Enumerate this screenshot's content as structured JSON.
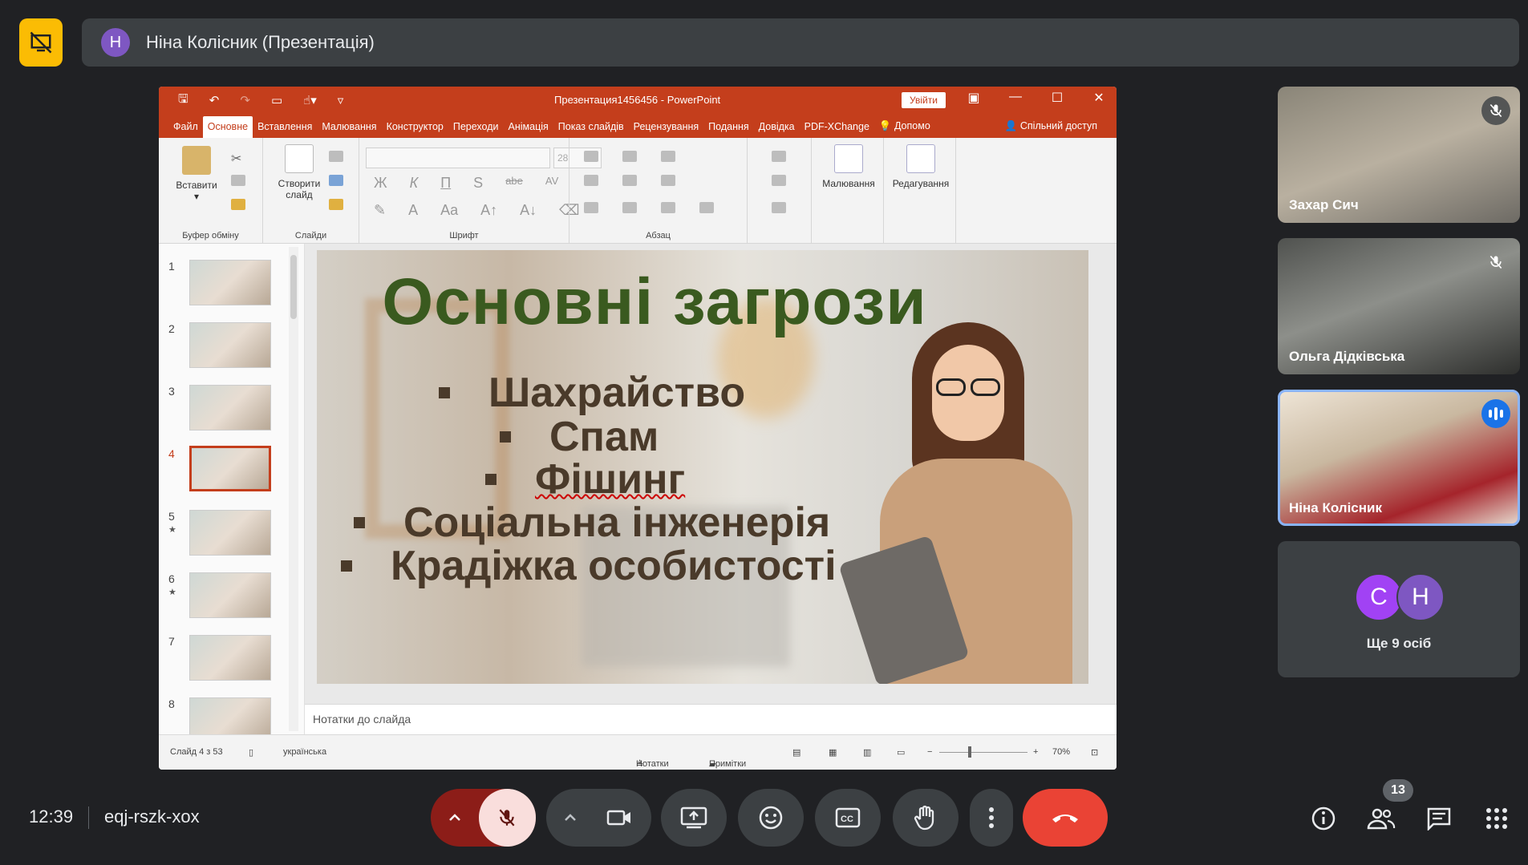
{
  "meet": {
    "presenter_initial": "Н",
    "presenter_name": "Ніна Колісник (Презентація)",
    "time": "12:39",
    "meeting_code": "eqj-rszk-xox",
    "participant_count": "13"
  },
  "powerpoint": {
    "doc_title": "Презентация1456456 - PowerPoint",
    "login_label": "Увійти",
    "tabs": [
      "Файл",
      "Основне",
      "Вставлення",
      "Малювання",
      "Конструктор",
      "Переходи",
      "Анімація",
      "Показ слайдів",
      "Рецензування",
      "Подання",
      "Довідка",
      "PDF-XChange",
      "Допомо"
    ],
    "share_label": "Спільний доступ",
    "ribbon": {
      "paste_label": "Вставити",
      "clipboard_group": "Буфер обміну",
      "new_slide_label": "Створити слайд",
      "slides_group": "Слайди",
      "font_group": "Шрифт",
      "font_size": "28",
      "paragraph_group": "Абзац",
      "drawing_label": "Малювання",
      "editing_label": "Редагування",
      "fmt_bold": "Ж",
      "fmt_italic": "К",
      "fmt_underline": "П",
      "fmt_shadow": "S",
      "fmt_strike": "abe",
      "fmt_spacing": "AV"
    },
    "thumb_numbers": [
      "1",
      "2",
      "3",
      "4",
      "5",
      "6",
      "7",
      "8"
    ],
    "selected_slide": "4",
    "slide": {
      "title": "Основні загрози",
      "bullets": [
        "Шахрайство",
        "Спам",
        "Фішинг",
        "Соціальна інженерія",
        "Крадіжка особистості"
      ]
    },
    "notes_placeholder": "Нотатки до слайда",
    "status": {
      "slide_info": "Слайд 4 з 53",
      "language": "українська",
      "notes_btn": "Нотатки",
      "comments_btn": "Примітки",
      "zoom": "70%"
    }
  },
  "participants": [
    {
      "name": "Захар Сич",
      "muted": true
    },
    {
      "name": "Ольга Дідківська",
      "muted": true
    },
    {
      "name": "Ніна Колісник",
      "speaking": true
    }
  ],
  "more_people": {
    "avatars": [
      "С",
      "Н"
    ],
    "label": "Ще 9 осіб"
  },
  "colors": {
    "ppt_accent": "#c43e1c",
    "meet_bg": "#202124",
    "hangup": "#ea4335",
    "present_badge": "#fbbc04"
  }
}
